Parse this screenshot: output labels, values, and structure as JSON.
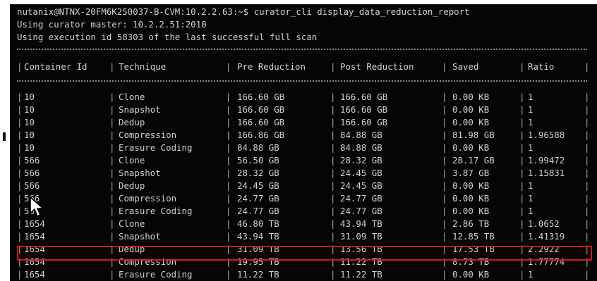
{
  "terminal": {
    "prompt_line": "nutanix@NTNX-20FM6K250037-B-CVM:10.2.2.63:~$ curator_cli display_data_reduction_report",
    "info_lines": [
      "Using curator master: 10.2.2.51:2010",
      "Using execution id 58303 of the last successful full scan"
    ]
  },
  "table": {
    "headers": [
      "Container Id",
      "Technique",
      "Pre Reduction",
      "Post Reduction",
      "Saved",
      "Ratio"
    ],
    "rows": [
      [
        "10",
        "Clone",
        "166.60 GB",
        "166.60 GB",
        "0.00 KB",
        "1"
      ],
      [
        "10",
        "Snapshot",
        "166.60 GB",
        "166.60 GB",
        "0.00 KB",
        "1"
      ],
      [
        "10",
        "Dedup",
        "166.60 GB",
        "166.60 GB",
        "0.00 KB",
        "1"
      ],
      [
        "10",
        "Compression",
        "166.86 GB",
        "84.88 GB",
        "81.98 GB",
        "1.96588"
      ],
      [
        "10",
        "Erasure Coding",
        "84.88 GB",
        "84.88 GB",
        "0.00 KB",
        "1"
      ],
      [
        "566",
        "Clone",
        "56.50 GB",
        "28.32 GB",
        "28.17 GB",
        "1.99472"
      ],
      [
        "566",
        "Snapshot",
        "28.32 GB",
        "24.45 GB",
        "3.87 GB",
        "1.15831"
      ],
      [
        "566",
        "Dedup",
        "24.45 GB",
        "24.45 GB",
        "0.00 KB",
        "1"
      ],
      [
        "566",
        "Compression",
        "24.77 GB",
        "24.77 GB",
        "0.00 KB",
        "1"
      ],
      [
        "566",
        "Erasure Coding",
        "24.77 GB",
        "24.77 GB",
        "0.00 KB",
        "1"
      ],
      [
        "1654",
        "Clone",
        "46.80 TB",
        "43.94 TB",
        "2.86 TB",
        "1.0652"
      ],
      [
        "1654",
        "Snapshot",
        "43.94 TB",
        "31.09 TB",
        "12.85 TB",
        "1.41319"
      ],
      [
        "1654",
        "Dedup",
        "31.09 TB",
        "13.56 TB",
        "17.53 TB",
        "2.2922"
      ],
      [
        "1654",
        "Compression",
        "19.95 TB",
        "11.22 TB",
        "8.73 TB",
        "1.77774"
      ],
      [
        "1654",
        "Erasure Coding",
        "11.22 TB",
        "11.22 TB",
        "0.00 KB",
        "1"
      ]
    ],
    "highlighted_row": 12
  },
  "colors": {
    "terminal_bg": "#050505",
    "terminal_text": "#d2d2d2",
    "highlight_border": "#d11a1a"
  },
  "icons": [
    "mouse-pointer-icon"
  ]
}
